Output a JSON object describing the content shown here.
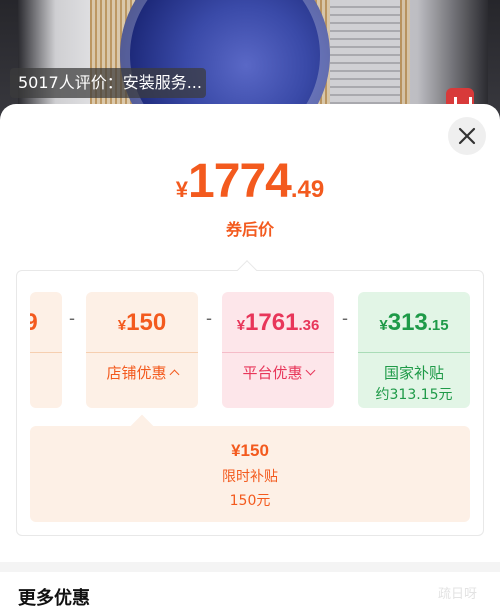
{
  "hero": {
    "caption": "5017人评价：安装服务..."
  },
  "price": {
    "symbol": "¥",
    "integer": "1774",
    "decimal": ".49",
    "label": "券后价"
  },
  "breakdown": {
    "partial_card": {
      "amount": "9"
    },
    "minus": "-",
    "store_discount": {
      "symbol": "¥",
      "amount": "150",
      "decimal": "",
      "label": "店铺优惠",
      "expanded": true
    },
    "platform_discount": {
      "symbol": "¥",
      "amount": "1761",
      "decimal": ".36",
      "label": "平台优惠",
      "expanded": false
    },
    "gov_subsidy": {
      "symbol": "¥",
      "amount": "313",
      "decimal": ".15",
      "label": "国家补贴",
      "sublabel": "约313.15元"
    }
  },
  "subsidy_detail": {
    "amount": "¥150",
    "title": "限时补贴",
    "note": "150元"
  },
  "more_offers": {
    "title": "更多优惠"
  },
  "watermark": "疏日呀",
  "colors": {
    "accent_orange": "#f35a1e",
    "platform_pink": "#e8365a",
    "gov_green": "#1e9a48"
  },
  "icons": {
    "close": "close-icon",
    "expand_up": "chevron-up-icon",
    "expand_down": "chevron-down-icon"
  }
}
